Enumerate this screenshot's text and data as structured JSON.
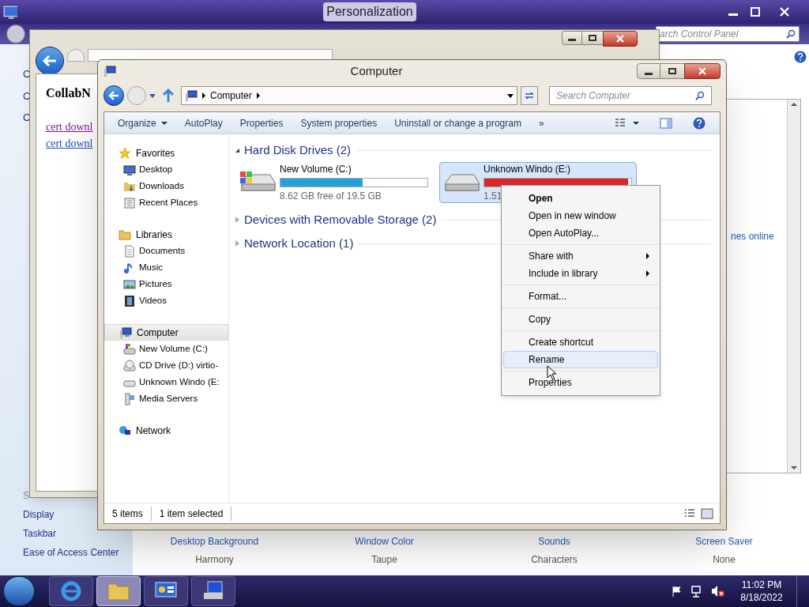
{
  "personalization": {
    "title": "Personalization",
    "search": {
      "placeholder": "arch Control Panel"
    },
    "left_letters": [
      "C",
      "C",
      "C"
    ],
    "see_also_heading": "S",
    "see_also": [
      "Display",
      "Taskbar",
      "Ease of Access Center"
    ],
    "partial_link": "nes online",
    "bottom_items": [
      {
        "label": "Desktop Background",
        "value": "Harmony"
      },
      {
        "label": "Window Color",
        "value": "Taupe"
      },
      {
        "label": "Sounds",
        "value": "Characters"
      },
      {
        "label": "Screen Saver",
        "value": "None"
      }
    ]
  },
  "browser": {
    "heading": "CollabN",
    "links": [
      {
        "text": "cert downl",
        "visited": true
      },
      {
        "text": "cert downl",
        "visited": false
      }
    ]
  },
  "explorer": {
    "title": "Computer",
    "breadcrumb": "Computer",
    "search": {
      "placeholder": "Search Computer"
    },
    "toolbar": [
      {
        "label": "Organize",
        "dropdown": true
      },
      {
        "label": "AutoPlay",
        "dropdown": false
      },
      {
        "label": "Properties",
        "dropdown": false
      },
      {
        "label": "System properties",
        "dropdown": false
      },
      {
        "label": "Uninstall or change a program",
        "dropdown": false
      },
      {
        "label": "»",
        "dropdown": false
      }
    ],
    "nav": [
      {
        "label": "Favorites",
        "selected": false,
        "children": [
          {
            "label": "Desktop",
            "selected": false
          },
          {
            "label": "Downloads",
            "selected": false
          },
          {
            "label": "Recent Places",
            "selected": false
          }
        ]
      },
      {
        "label": "Libraries",
        "selected": false,
        "children": [
          {
            "label": "Documents",
            "selected": false
          },
          {
            "label": "Music",
            "selected": false
          },
          {
            "label": "Pictures",
            "selected": false
          },
          {
            "label": "Videos",
            "selected": false
          }
        ]
      },
      {
        "label": "Computer",
        "selected": true,
        "children": [
          {
            "label": "New Volume (C:)",
            "selected": false
          },
          {
            "label": "CD Drive (D:) virtio-",
            "selected": false
          },
          {
            "label": "Unknown Windo (E:",
            "selected": false
          },
          {
            "label": "Media Servers",
            "selected": false
          }
        ]
      },
      {
        "label": "Network",
        "selected": false
      }
    ],
    "groups": [
      {
        "title": "Hard Disk Drives (2)",
        "expanded": true,
        "drives": [
          {
            "name": "New Volume (C:)",
            "level": 0.56,
            "color": "#26a0da",
            "free": "8.62 GB free of 19.5 GB",
            "selected": false,
            "system": true
          },
          {
            "name": "Unknown Windo (E:)",
            "level": 0.98,
            "color": "#da2626",
            "free": "1.51",
            "selected": true,
            "system": false
          }
        ]
      },
      {
        "title": "Devices with Removable Storage (2)",
        "expanded": false
      },
      {
        "title": "Network Location (1)",
        "expanded": false
      }
    ],
    "status": [
      "5 items",
      "1 item selected"
    ]
  },
  "context_menu": {
    "groups": [
      [
        {
          "label": "Open",
          "default": true,
          "submenu": false,
          "selected": false
        },
        {
          "label": "Open in new window",
          "default": false,
          "submenu": false,
          "selected": false
        },
        {
          "label": "Open AutoPlay...",
          "default": false,
          "submenu": false,
          "selected": false
        }
      ],
      [
        {
          "label": "Share with",
          "default": false,
          "submenu": true,
          "selected": false
        },
        {
          "label": "Include in library",
          "default": false,
          "submenu": true,
          "selected": false
        }
      ],
      [
        {
          "label": "Format...",
          "default": false,
          "submenu": false,
          "selected": false
        }
      ],
      [
        {
          "label": "Copy",
          "default": false,
          "submenu": false,
          "selected": false
        }
      ],
      [
        {
          "label": "Create shortcut",
          "default": false,
          "submenu": false,
          "selected": false
        },
        {
          "label": "Rename",
          "default": false,
          "submenu": false,
          "selected": true
        }
      ],
      [
        {
          "label": "Properties",
          "default": false,
          "submenu": false,
          "selected": false
        }
      ]
    ]
  },
  "taskbar": {
    "buttons": [
      {
        "active": false
      },
      {
        "active": true
      },
      {
        "active": false
      },
      {
        "active": false
      }
    ],
    "time": "11:02 PM",
    "date": "8/18/2022"
  }
}
